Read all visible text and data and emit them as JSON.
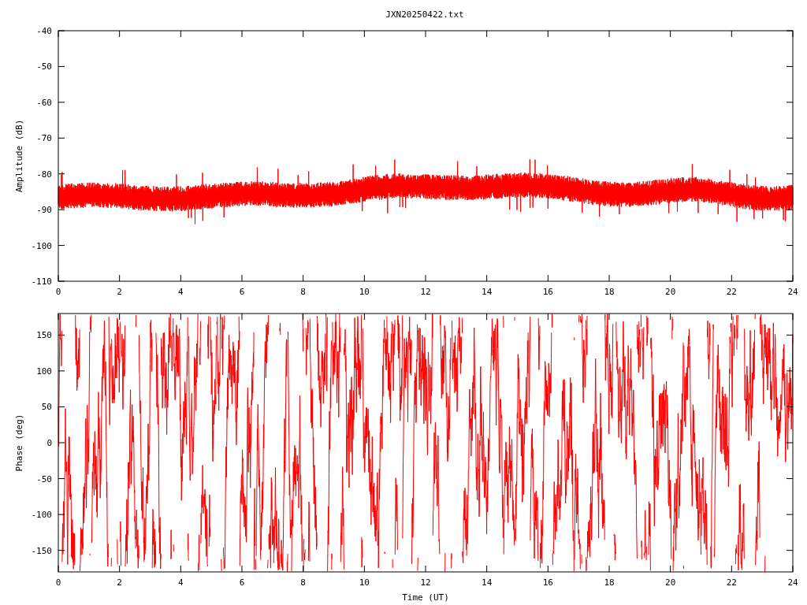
{
  "title": "JXN20250422.txt",
  "panels": [
    {
      "ylabel": "Amplitude (dB)",
      "yticks": [
        "-40",
        "-50",
        "-60",
        "-70",
        "-80",
        "-90",
        "-100",
        "-110"
      ],
      "xticks": [
        "0",
        "2",
        "4",
        "6",
        "8",
        "10",
        "12",
        "14",
        "16",
        "18",
        "20",
        "22",
        "24"
      ]
    },
    {
      "ylabel": "Phase (deg)",
      "yticks": [
        "150",
        "100",
        "50",
        "0",
        "-50",
        "-100",
        "-150"
      ],
      "xticks": [
        "0",
        "2",
        "4",
        "6",
        "8",
        "10",
        "12",
        "14",
        "16",
        "18",
        "20",
        "22",
        "24"
      ],
      "xlabel": "Time (UT)"
    }
  ]
}
